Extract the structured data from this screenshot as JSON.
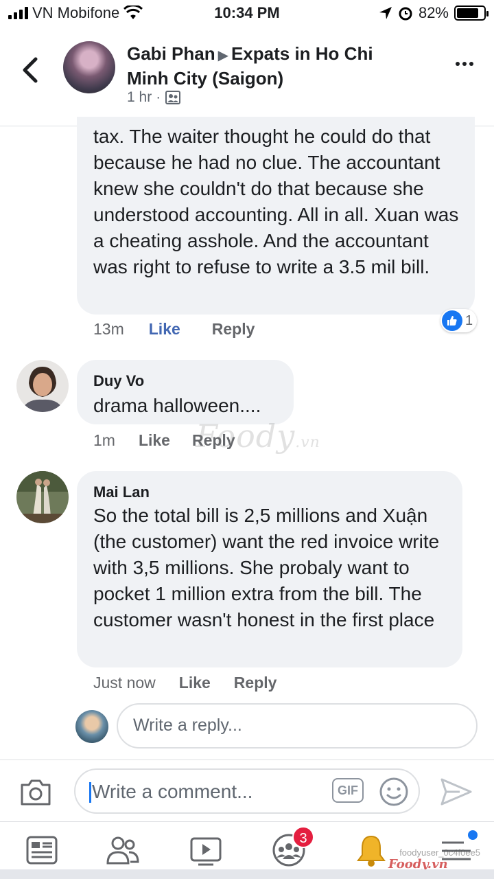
{
  "status_bar": {
    "carrier": "VN Mobifone",
    "time": "10:34 PM",
    "battery": "82%",
    "battery_level": 0.82
  },
  "header": {
    "author": "Gabi Phan",
    "group": "Expats in Ho Chi Minh City (Saigon)",
    "time": "1 hr",
    "dot": "·"
  },
  "comments": [
    {
      "text": "tax. The waiter thought he could do that because he had no clue. The accountant knew she couldn't do that because she understood accounting. All in all. Xuan was a cheating asshole. And the accountant was right to refuse to write a 3.5 mil bill.",
      "time": "13m",
      "like_label": "Like",
      "reply_label": "Reply",
      "reaction_count": "1"
    },
    {
      "author": "Duy Vo",
      "text": "drama halloween....",
      "time": "1m",
      "like_label": "Like",
      "reply_label": "Reply"
    },
    {
      "author": "Mai Lan",
      "text": "So the total bill is 2,5 millions and Xuận (the customer) want the red invoice write with 3,5 millions. She probaly want to pocket 1 million extra from the bill. The customer wasn't honest in the first place",
      "time": "Just now",
      "like_label": "Like",
      "reply_label": "Reply"
    }
  ],
  "reply_box": {
    "placeholder": "Write a reply..."
  },
  "composer": {
    "placeholder": "Write a comment...",
    "gif_label": "GIF"
  },
  "bottom_nav": {
    "groups_badge": "3"
  },
  "watermark": {
    "brand": "Foody",
    "suffix": ".vn",
    "user": "foodyuser_0c4f0ee5"
  },
  "colors": {
    "accent": "#4267b2",
    "bubble": "#f0f2f5",
    "badge": "#e41e3f"
  }
}
